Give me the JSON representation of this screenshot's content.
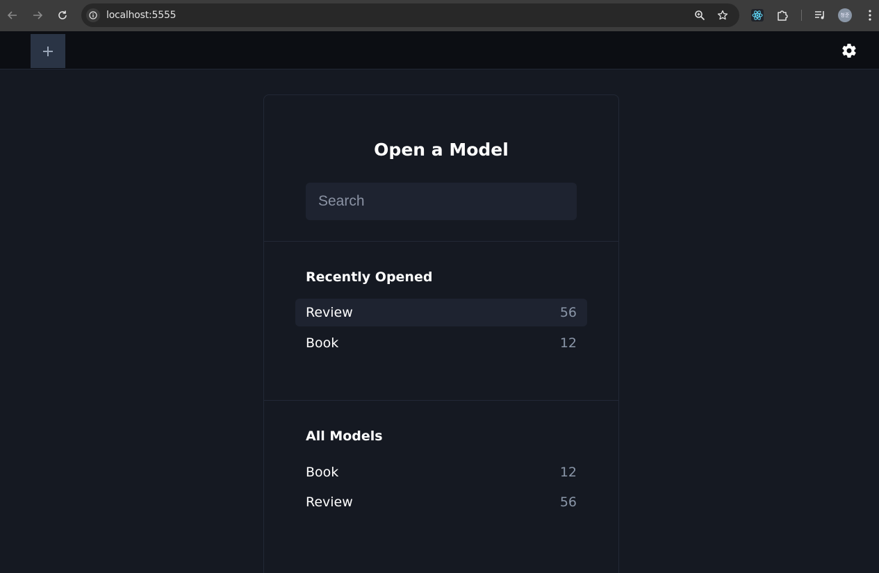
{
  "browser": {
    "url": "localhost:5555",
    "avatar_text": "청준"
  },
  "app": {
    "add_tab_label": "+",
    "panel_title": "Open a Model",
    "search": {
      "placeholder": "Search",
      "value": ""
    },
    "recent": {
      "title": "Recently Opened",
      "items": [
        {
          "name": "Review",
          "count": "56",
          "highlighted": true
        },
        {
          "name": "Book",
          "count": "12",
          "highlighted": false
        }
      ]
    },
    "all": {
      "title": "All Models",
      "items": [
        {
          "name": "Book",
          "count": "12"
        },
        {
          "name": "Review",
          "count": "56"
        }
      ]
    }
  },
  "colors": {
    "background": "#151922",
    "header": "#0c0e13",
    "accent_tab": "#2a3445",
    "count_text": "#8a96a8"
  }
}
